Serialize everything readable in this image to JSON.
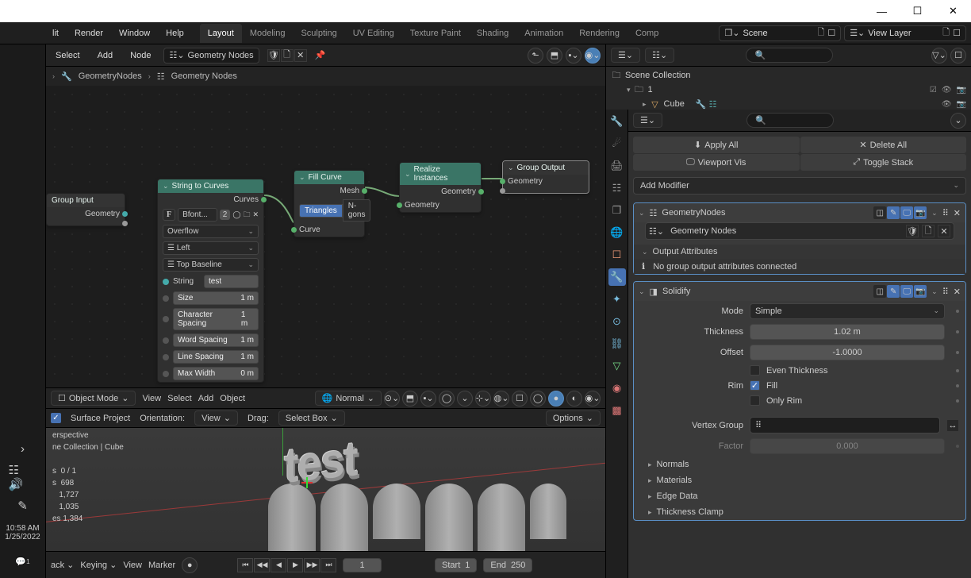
{
  "titlebar": {
    "min": "—",
    "max": "☐",
    "close": "✕"
  },
  "menu": {
    "edit": "lit",
    "render": "Render",
    "window": "Window",
    "help": "Help"
  },
  "workspaces": {
    "layout": "Layout",
    "modeling": "Modeling",
    "sculpting": "Sculpting",
    "uv": "UV Editing",
    "texture": "Texture Paint",
    "shading": "Shading",
    "animation": "Animation",
    "rendering": "Rendering",
    "comp": "Comp"
  },
  "scene": {
    "scene": "Scene",
    "viewlayer": "View Layer"
  },
  "nodeHeader": {
    "select": "Select",
    "add": "Add",
    "node": "Node",
    "tree": "Geometry Nodes"
  },
  "breadcrumb": {
    "a": "GeometryNodes",
    "b": "Geometry Nodes"
  },
  "nodes": {
    "groupInput": {
      "title": "Group Input",
      "out1": "Geometry"
    },
    "stringToCurves": {
      "title": "String to Curves",
      "out1": "Curves",
      "font": "Bfont...",
      "font_users": "2",
      "overflow": "Overflow",
      "align": "Left",
      "baseline": "Top Baseline",
      "string_lbl": "String",
      "string_val": "test",
      "size_lbl": "Size",
      "size_val": "1 m",
      "cspace_lbl": "Character Spacing",
      "cspace_val": "1 m",
      "wspace_lbl": "Word Spacing",
      "wspace_val": "1 m",
      "lspace_lbl": "Line Spacing",
      "lspace_val": "1 m",
      "maxw_lbl": "Max Width",
      "maxw_val": "0 m"
    },
    "fillCurve": {
      "title": "Fill Curve",
      "out1": "Mesh",
      "tri": "Triangles",
      "ngon": "N-gons",
      "in1": "Curve"
    },
    "realize": {
      "title": "Realize Instances",
      "out1": "Geometry",
      "in1": "Geometry"
    },
    "groupOutput": {
      "title": "Group Output",
      "in1": "Geometry"
    }
  },
  "viewport": {
    "mode": "Object Mode",
    "view": "View",
    "select": "Select",
    "add": "Add",
    "object": "Object",
    "shading": "Normal",
    "surface": "Surface Project",
    "orientation": "Orientation:",
    "orient_val": "View",
    "drag": "Drag:",
    "drag_val": "Select Box",
    "options": "Options",
    "persp": "erspective",
    "coll": "ne Collection | Cube",
    "s1": "0 / 1",
    "s2": "698",
    "s3": "1,727",
    "s4": "1,035",
    "s5": "1,384",
    "s5lbl": "es",
    "text3d": "test"
  },
  "timeline": {
    "back": "ack",
    "keying": "Keying",
    "view": "View",
    "marker": "Marker",
    "frame": "1",
    "start": "Start",
    "start_v": "1",
    "end": "End",
    "end_v": "250"
  },
  "outliner": {
    "scene_coll": "Scene Collection",
    "coll1": "1",
    "cube": "Cube"
  },
  "props": {
    "apply_all": "Apply All",
    "delete_all": "Delete All",
    "viewport_vis": "Viewport Vis",
    "toggle_stack": "Toggle Stack",
    "add_modifier": "Add Modifier",
    "gn_name": "GeometryNodes",
    "gn_tree": "Geometry Nodes",
    "out_attrs": "Output Attributes",
    "no_attrs": "No group output attributes connected",
    "solidify_name": "Solidify",
    "mode_lbl": "Mode",
    "mode_val": "Simple",
    "thick_lbl": "Thickness",
    "thick_val": "1.02 m",
    "offset_lbl": "Offset",
    "offset_val": "-1.0000",
    "even_lbl": "Even Thickness",
    "rim_lbl": "Rim",
    "fill_lbl": "Fill",
    "only_rim_lbl": "Only Rim",
    "vgroup_lbl": "Vertex Group",
    "factor_lbl": "Factor",
    "factor_val": "0.000",
    "normals": "Normals",
    "materials": "Materials",
    "edge_data": "Edge Data",
    "thick_clamp": "Thickness Clamp"
  },
  "sidebar": {
    "time": "10:58 AM",
    "date": "1/25/2022"
  }
}
